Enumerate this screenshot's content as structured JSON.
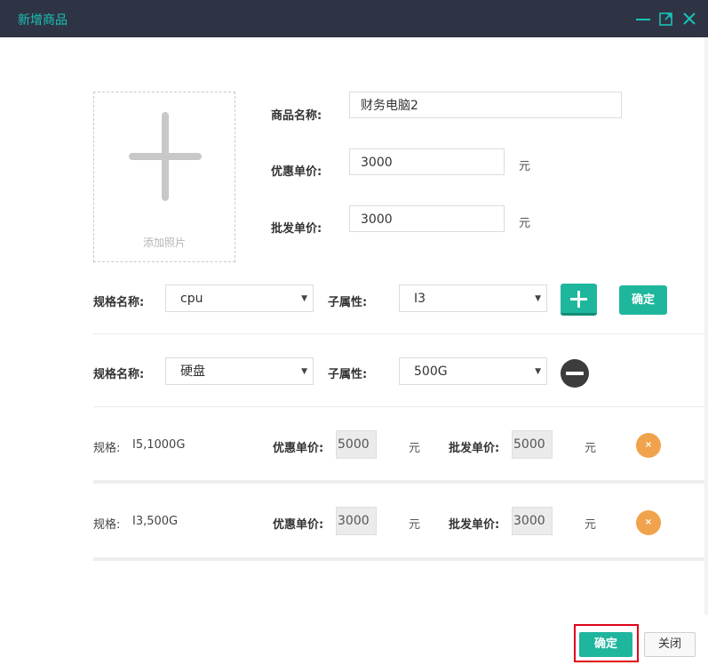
{
  "dialog": {
    "title": "新增商品",
    "controls": [
      "minimize-icon",
      "maximize-icon",
      "close-icon"
    ]
  },
  "photo": {
    "label": "添加照片",
    "icon": "plus-icon"
  },
  "product": {
    "name_label": "商品名称:",
    "name_value": "财务电脑2",
    "discount_label": "优惠单价:",
    "discount_value": "3000",
    "discount_unit": "元",
    "wholesale_label": "批发单价:",
    "wholesale_value": "3000",
    "wholesale_unit": "元"
  },
  "spec_rows": [
    {
      "name_label": "规格名称:",
      "name_value": "cpu",
      "sub_label": "子属性:",
      "sub_value": "I3",
      "add_icon": "plus-icon",
      "confirm_label": "确定"
    },
    {
      "name_label": "规格名称:",
      "name_value": "硬盘",
      "sub_label": "子属性:",
      "sub_value": "500G",
      "remove_icon": "minus-icon"
    }
  ],
  "variants": [
    {
      "spec_label": "规格:",
      "spec_value": "I5,1000G",
      "discount_label": "优惠单价:",
      "discount_value": "5000",
      "discount_unit": "元",
      "wholesale_label": "批发单价:",
      "wholesale_value": "5000",
      "wholesale_unit": "元",
      "delete_icon": "×"
    },
    {
      "spec_label": "规格:",
      "spec_value": "I3,500G",
      "discount_label": "优惠单价:",
      "discount_value": "3000",
      "discount_unit": "元",
      "wholesale_label": "批发单价:",
      "wholesale_value": "3000",
      "wholesale_unit": "元",
      "delete_icon": "×"
    }
  ],
  "footer": {
    "confirm_label": "确定",
    "close_label": "关闭"
  },
  "colors": {
    "titlebar": "#2f3445",
    "title": "#19c3b5",
    "accent": "#1fb69e",
    "delete": "#f0a34c",
    "highlight": "#e0001a"
  }
}
